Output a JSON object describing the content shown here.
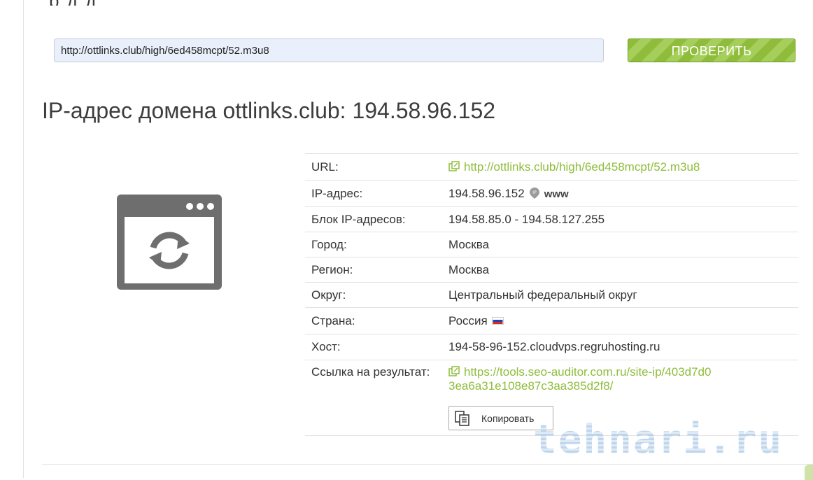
{
  "header": {
    "title_fragment": "р д д"
  },
  "search": {
    "url_value": "http://ottlinks.club/high/6ed458mcpt/52.m3u8",
    "check_label": "ПРОВЕРИТЬ"
  },
  "result": {
    "title": "IP-адрес домена ottlinks.club: 194.58.96.152",
    "site_icon": "browser-window-refresh-icon",
    "rows": {
      "url": {
        "label": "URL:",
        "value": "http://ottlinks.club/high/6ed458mcpt/52.m3u8"
      },
      "ip": {
        "label": "IP-адрес:",
        "value": "194.58.96.152",
        "badge": "www"
      },
      "block": {
        "label": "Блок IP-адресов:",
        "value": "194.58.85.0 - 194.58.127.255"
      },
      "city": {
        "label": "Город:",
        "value": "Москва"
      },
      "region": {
        "label": "Регион:",
        "value": "Москва"
      },
      "district": {
        "label": "Округ:",
        "value": "Центральный федеральный округ"
      },
      "country": {
        "label": "Страна:",
        "value": "Россия",
        "flag": "russia-flag-icon"
      },
      "host": {
        "label": "Хост:",
        "value": "194-58-96-152.cloudvps.regruhosting.ru"
      },
      "result_link": {
        "label": "Ссылка на результат:",
        "value": "https://tools.seo-auditor.com.ru/site-ip/403d7d03ea6a31e108e87c3aa385d2f8/",
        "copy_label": "Копировать"
      }
    }
  },
  "watermark": "tehnari.ru",
  "colors": {
    "accent_green": "#8fbd3b",
    "icon_gray": "#6e6e6e",
    "input_bg": "#e9f0fb"
  }
}
